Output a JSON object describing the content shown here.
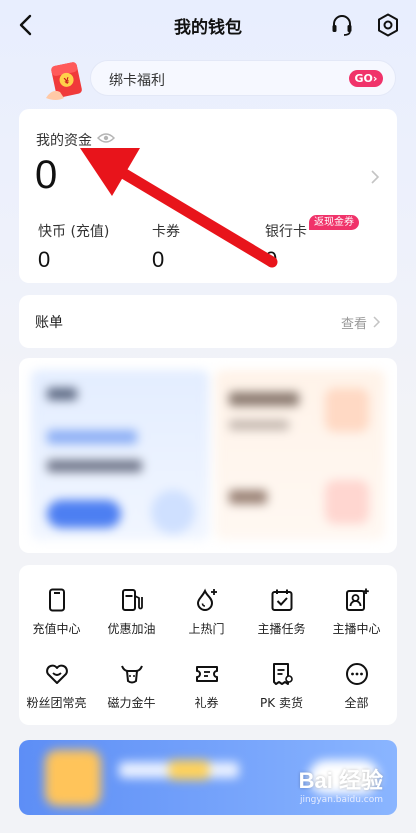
{
  "header": {
    "title": "我的钱包"
  },
  "promo": {
    "text": "绑卡福利",
    "go_label": "GO"
  },
  "funds": {
    "label": "我的资金",
    "value": "0",
    "items": [
      {
        "label": "快币 (充值)",
        "value": "0"
      },
      {
        "label": "卡券",
        "value": "0"
      },
      {
        "label": "银行卡",
        "value": "0",
        "badge": "返现金券"
      }
    ]
  },
  "bill": {
    "label": "账单",
    "link": "查看"
  },
  "services": [
    {
      "label": "充值中心",
      "icon": "phone-icon"
    },
    {
      "label": "优惠加油",
      "icon": "gas-pump-icon"
    },
    {
      "label": "上热门",
      "icon": "flame-plus-icon"
    },
    {
      "label": "主播任务",
      "icon": "calendar-check-icon"
    },
    {
      "label": "主播中心",
      "icon": "anchor-profile-icon"
    },
    {
      "label": "粉丝团常亮",
      "icon": "heart-team-icon"
    },
    {
      "label": "磁力金牛",
      "icon": "bull-icon"
    },
    {
      "label": "礼券",
      "icon": "ticket-icon"
    },
    {
      "label": "PK 卖货",
      "icon": "receipt-icon"
    },
    {
      "label": "全部",
      "icon": "more-icon"
    }
  ],
  "watermark": {
    "main": "Bai 经验",
    "sub": "jingyan.baidu.com"
  },
  "colors": {
    "accent": "#f0336a",
    "annotation": "#e8141b"
  }
}
